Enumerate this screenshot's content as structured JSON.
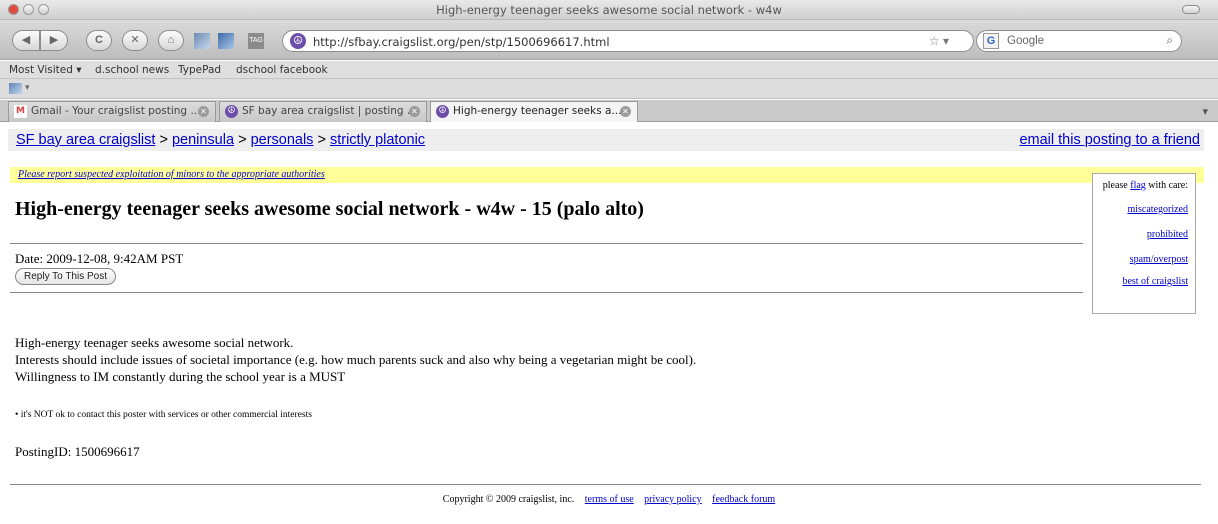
{
  "window": {
    "title": "High-energy teenager seeks awesome social network - w4w"
  },
  "toolbar": {
    "url": "http://sfbay.craigslist.org/pen/stp/1500696617.html",
    "search_placeholder": "Google"
  },
  "bookmarks": [
    "Most Visited ▾",
    "d.school news",
    "TypePad",
    "dschool facebook"
  ],
  "tabs": [
    {
      "label": "Gmail - Your craigslist posting ...",
      "active": false
    },
    {
      "label": "SF bay area craigslist | posting ...",
      "active": false
    },
    {
      "label": "High-energy teenager seeks a...",
      "active": true
    }
  ],
  "page": {
    "breadcrumb": {
      "site": "SF bay area craigslist",
      "sep": ">",
      "level1": "peninsula",
      "level2": "personals",
      "level3": "strictly platonic"
    },
    "email_link": "email this posting to a friend",
    "warning": "Please report suspected exploitation of minors to the appropriate authorities",
    "title": "High-energy teenager seeks awesome social network - w4w - 15 (palo alto)",
    "date": "Date: 2009-12-08, 9:42AM PST",
    "reply_button": "Reply To This Post",
    "body": [
      "High-energy teenager seeks awesome social network.",
      "Interests should include issues of societal importance (e.g. how much parents suck and also why being a vegetarian might be cool).",
      "Willingness to IM constantly during the school year is a MUST"
    ],
    "notice": "it's NOT ok to contact this poster with services or other commercial interests",
    "posting_id": "PostingID: 1500696617",
    "flag": {
      "prefix": "please",
      "flag_link": "flag",
      "suffix": "with care:",
      "items": [
        "miscategorized",
        "prohibited",
        "spam/overpost",
        "best of craigslist"
      ]
    },
    "footer": {
      "copyright": "Copyright © 2009 craigslist, inc.",
      "links": [
        "terms of use",
        "privacy policy",
        "feedback forum"
      ]
    }
  }
}
